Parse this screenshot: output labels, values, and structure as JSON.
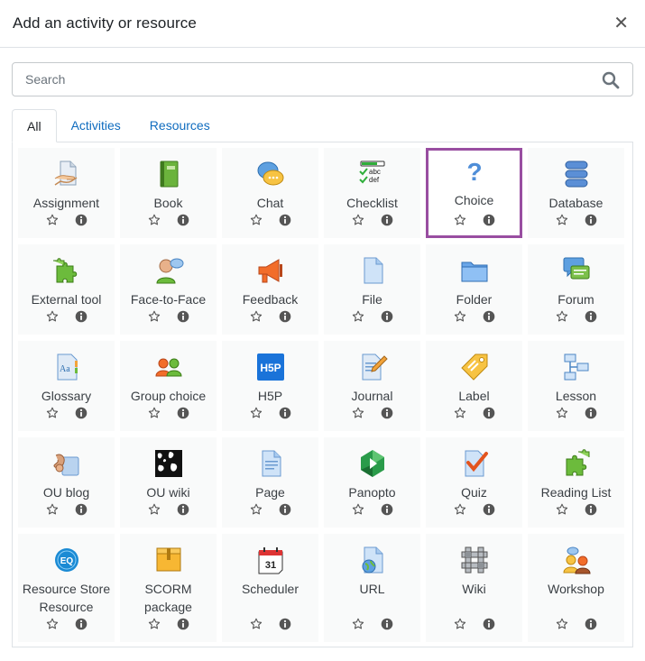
{
  "modal": {
    "title": "Add an activity or resource"
  },
  "search": {
    "placeholder": "Search"
  },
  "tabs": [
    {
      "label": "All",
      "active": true
    },
    {
      "label": "Activities",
      "active": false
    },
    {
      "label": "Resources",
      "active": false
    }
  ],
  "items": [
    {
      "label": "Assignment",
      "icon": "assignment-icon"
    },
    {
      "label": "Book",
      "icon": "book-icon"
    },
    {
      "label": "Chat",
      "icon": "chat-icon"
    },
    {
      "label": "Checklist",
      "icon": "checklist-icon",
      "icon_text": [
        "abc",
        "def"
      ]
    },
    {
      "label": "Choice",
      "icon": "choice-icon",
      "selected": true
    },
    {
      "label": "Database",
      "icon": "database-icon"
    },
    {
      "label": "External tool",
      "icon": "external-tool-icon"
    },
    {
      "label": "Face-to-Face",
      "icon": "face-to-face-icon"
    },
    {
      "label": "Feedback",
      "icon": "feedback-icon"
    },
    {
      "label": "File",
      "icon": "file-icon"
    },
    {
      "label": "Folder",
      "icon": "folder-icon"
    },
    {
      "label": "Forum",
      "icon": "forum-icon"
    },
    {
      "label": "Glossary",
      "icon": "glossary-icon",
      "icon_text": "Aa"
    },
    {
      "label": "Group choice",
      "icon": "group-choice-icon"
    },
    {
      "label": "H5P",
      "icon": "h5p-icon",
      "icon_text": "H5P"
    },
    {
      "label": "Journal",
      "icon": "journal-icon"
    },
    {
      "label": "Label",
      "icon": "label-icon"
    },
    {
      "label": "Lesson",
      "icon": "lesson-icon"
    },
    {
      "label": "OU blog",
      "icon": "ou-blog-icon"
    },
    {
      "label": "OU wiki",
      "icon": "ou-wiki-icon"
    },
    {
      "label": "Page",
      "icon": "page-icon"
    },
    {
      "label": "Panopto",
      "icon": "panopto-icon"
    },
    {
      "label": "Quiz",
      "icon": "quiz-icon"
    },
    {
      "label": "Reading List",
      "icon": "reading-list-icon"
    },
    {
      "label": "Resource Store Resource",
      "icon": "resource-store-icon",
      "icon_text": "EQ"
    },
    {
      "label": "SCORM package",
      "icon": "scorm-package-icon"
    },
    {
      "label": "Scheduler",
      "icon": "scheduler-icon",
      "icon_text": "31"
    },
    {
      "label": "URL",
      "icon": "url-icon"
    },
    {
      "label": "Wiki",
      "icon": "wiki-icon"
    },
    {
      "label": "Workshop",
      "icon": "workshop-icon"
    }
  ],
  "colors": {
    "link": "#0f6cbf",
    "selected_border": "#994ea1",
    "card_bg": "#f9fafa"
  }
}
